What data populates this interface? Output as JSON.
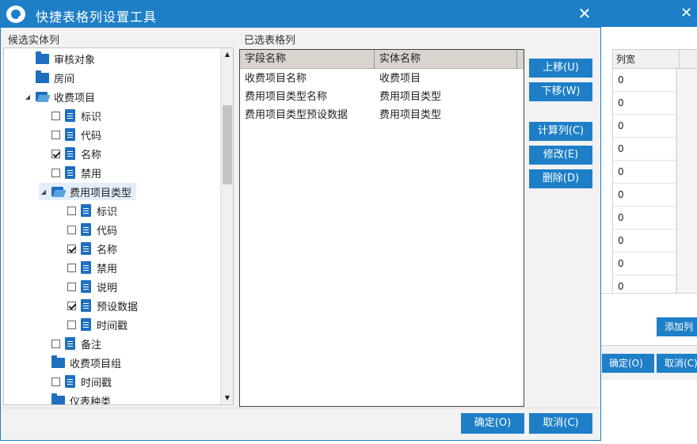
{
  "dialog": {
    "title": "快捷表格列设置工具",
    "close_symbol": "✕",
    "left_panel_label": "候选实体列",
    "right_panel_label": "已选表格列"
  },
  "tree": {
    "items": [
      {
        "label": "审核对象",
        "type": "folder",
        "level": 1,
        "expander": "",
        "checkbox": "none"
      },
      {
        "label": "房间",
        "type": "folder",
        "level": 1,
        "expander": "",
        "checkbox": "none"
      },
      {
        "label": "收费项目",
        "type": "folder-open",
        "level": 1,
        "expander": "◢",
        "checkbox": "none"
      },
      {
        "label": "标识",
        "type": "doc",
        "level": 2,
        "expander": "",
        "checkbox": "unchecked"
      },
      {
        "label": "代码",
        "type": "doc",
        "level": 2,
        "expander": "",
        "checkbox": "unchecked"
      },
      {
        "label": "名称",
        "type": "doc",
        "level": 2,
        "expander": "",
        "checkbox": "checked"
      },
      {
        "label": "禁用",
        "type": "doc",
        "level": 2,
        "expander": "",
        "checkbox": "unchecked"
      },
      {
        "label": "费用项目类型",
        "type": "folder-open",
        "level": 2,
        "expander": "◢",
        "checkbox": "none",
        "selected": true
      },
      {
        "label": "标识",
        "type": "doc",
        "level": 3,
        "expander": "",
        "checkbox": "unchecked"
      },
      {
        "label": "代码",
        "type": "doc",
        "level": 3,
        "expander": "",
        "checkbox": "unchecked"
      },
      {
        "label": "名称",
        "type": "doc",
        "level": 3,
        "expander": "",
        "checkbox": "checked"
      },
      {
        "label": "禁用",
        "type": "doc",
        "level": 3,
        "expander": "",
        "checkbox": "unchecked"
      },
      {
        "label": "说明",
        "type": "doc",
        "level": 3,
        "expander": "",
        "checkbox": "unchecked"
      },
      {
        "label": "预设数据",
        "type": "doc",
        "level": 3,
        "expander": "",
        "checkbox": "checked"
      },
      {
        "label": "时间戳",
        "type": "doc",
        "level": 3,
        "expander": "",
        "checkbox": "unchecked"
      },
      {
        "label": "备注",
        "type": "doc",
        "level": 2,
        "expander": "",
        "checkbox": "unchecked"
      },
      {
        "label": "收费项目组",
        "type": "folder",
        "level": 2,
        "expander": "",
        "checkbox": "none"
      },
      {
        "label": "时间戳",
        "type": "doc",
        "level": 2,
        "expander": "",
        "checkbox": "unchecked"
      },
      {
        "label": "仪表种类",
        "type": "folder",
        "level": 2,
        "expander": "",
        "checkbox": "none"
      }
    ],
    "scroll_up": "▲",
    "scroll_down": "▼"
  },
  "grid": {
    "headers": [
      "字段名称",
      "实体名称"
    ],
    "rows": [
      [
        "收费项目名称",
        "收费项目"
      ],
      [
        "费用项目类型名称",
        "费用项目类型"
      ],
      [
        "费用项目类型预设数据",
        "费用项目类型"
      ]
    ]
  },
  "buttons": {
    "move_up": "上移(U)",
    "move_down": "下移(W)",
    "compute": "计算列(C)",
    "modify": "修改(E)",
    "delete": "删除(D)",
    "ok": "确定(O)",
    "cancel": "取消(C)"
  },
  "background_window": {
    "close_symbol": "✕",
    "column_header": "列宽",
    "values": [
      "0",
      "0",
      "0",
      "0",
      "0",
      "0",
      "0",
      "0",
      "0",
      "0"
    ],
    "add_column": "添加列",
    "ok": "确定(O)",
    "cancel": "取消(C)"
  },
  "colors": {
    "accent": "#1e7fc7",
    "icon_blue": "#1e6fbf",
    "grid_header": "#d9d4cd"
  }
}
